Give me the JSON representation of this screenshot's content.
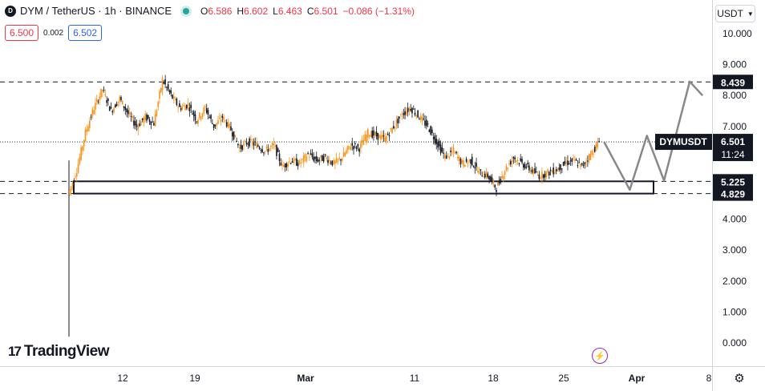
{
  "header": {
    "logo_letter": "D",
    "title": "DYM / TetherUS · 1h · BINANCE",
    "ohlc": [
      {
        "key": "O",
        "value": "6.586"
      },
      {
        "key": "H",
        "value": "6.602"
      },
      {
        "key": "L",
        "value": "6.463"
      },
      {
        "key": "C",
        "value": "6.501"
      },
      {
        "key": "",
        "value": "−0.086 (−1.31%)"
      }
    ]
  },
  "trade": {
    "sell_price": "6.500",
    "spread": "0.002",
    "buy_price": "6.502"
  },
  "currency": {
    "label": "USDT",
    "icon": "chevron-down-icon"
  },
  "colors": {
    "up": "#f7931a",
    "down": "#131722",
    "accent_red": "#f23645",
    "accent_blue": "#2962ff",
    "live_green": "#26a69a",
    "projection": "#888888"
  },
  "chart_data": {
    "type": "candlestick",
    "y_axis_ticks": [
      "10.000",
      "9.000",
      "8.000",
      "7.000",
      "4.000",
      "3.000",
      "2.000",
      "1.000",
      "0.000"
    ],
    "ylim": [
      0,
      10.6
    ],
    "x_axis_ticks": [
      "12",
      "19",
      "Mar",
      "11",
      "18",
      "25",
      "Apr",
      "8"
    ],
    "price_series": [
      {
        "t": 0,
        "v": 4.8
      },
      {
        "t": 1,
        "v": 5.6
      },
      {
        "t": 2,
        "v": 6.8
      },
      {
        "t": 3,
        "v": 7.6
      },
      {
        "t": 4,
        "v": 8.2
      },
      {
        "t": 5,
        "v": 7.5
      },
      {
        "t": 6,
        "v": 7.9
      },
      {
        "t": 7,
        "v": 7.4
      },
      {
        "t": 8,
        "v": 7.0
      },
      {
        "t": 9,
        "v": 7.3
      },
      {
        "t": 10,
        "v": 7.1
      },
      {
        "t": 11,
        "v": 8.5
      },
      {
        "t": 12,
        "v": 8.0
      },
      {
        "t": 13,
        "v": 7.6
      },
      {
        "t": 14,
        "v": 7.7
      },
      {
        "t": 15,
        "v": 7.2
      },
      {
        "t": 16,
        "v": 7.6
      },
      {
        "t": 17,
        "v": 7.0
      },
      {
        "t": 18,
        "v": 7.3
      },
      {
        "t": 19,
        "v": 6.9
      },
      {
        "t": 20,
        "v": 6.3
      },
      {
        "t": 21,
        "v": 6.5
      },
      {
        "t": 22,
        "v": 6.4
      },
      {
        "t": 23,
        "v": 6.2
      },
      {
        "t": 24,
        "v": 6.4
      },
      {
        "t": 25,
        "v": 5.7
      },
      {
        "t": 26,
        "v": 5.9
      },
      {
        "t": 27,
        "v": 5.8
      },
      {
        "t": 28,
        "v": 6.1
      },
      {
        "t": 29,
        "v": 5.9
      },
      {
        "t": 30,
        "v": 6.0
      },
      {
        "t": 31,
        "v": 5.8
      },
      {
        "t": 32,
        "v": 6.0
      },
      {
        "t": 33,
        "v": 6.4
      },
      {
        "t": 34,
        "v": 6.3
      },
      {
        "t": 35,
        "v": 6.8
      },
      {
        "t": 36,
        "v": 6.7
      },
      {
        "t": 37,
        "v": 6.6
      },
      {
        "t": 38,
        "v": 7.0
      },
      {
        "t": 39,
        "v": 7.4
      },
      {
        "t": 40,
        "v": 7.6
      },
      {
        "t": 41,
        "v": 7.3
      },
      {
        "t": 42,
        "v": 7.0
      },
      {
        "t": 43,
        "v": 6.5
      },
      {
        "t": 44,
        "v": 6.0
      },
      {
        "t": 45,
        "v": 6.2
      },
      {
        "t": 46,
        "v": 5.8
      },
      {
        "t": 47,
        "v": 5.9
      },
      {
        "t": 48,
        "v": 5.5
      },
      {
        "t": 49,
        "v": 5.4
      },
      {
        "t": 50,
        "v": 5.0
      },
      {
        "t": 51,
        "v": 5.6
      },
      {
        "t": 52,
        "v": 6.0
      },
      {
        "t": 53,
        "v": 5.8
      },
      {
        "t": 54,
        "v": 5.6
      },
      {
        "t": 55,
        "v": 5.4
      },
      {
        "t": 56,
        "v": 5.5
      },
      {
        "t": 57,
        "v": 5.6
      },
      {
        "t": 58,
        "v": 5.8
      },
      {
        "t": 59,
        "v": 5.9
      },
      {
        "t": 60,
        "v": 5.7
      },
      {
        "t": 61,
        "v": 6.1
      },
      {
        "t": 62,
        "v": 6.5
      }
    ],
    "price_series_t_max": 62,
    "horizontal_levels": [
      {
        "value": 8.439,
        "label": "8.439"
      },
      {
        "value": 5.225,
        "label": "5.225"
      },
      {
        "value": 4.829,
        "label": "4.829"
      }
    ],
    "current_price": {
      "value": 6.501,
      "label": "6.501",
      "symbol": "DYMUSDT",
      "countdown": "11:24"
    },
    "zone": {
      "low": 4.829,
      "high": 5.225
    },
    "projection_path": [
      {
        "t": 62.5,
        "v": 6.5
      },
      {
        "t": 65.5,
        "v": 4.95
      },
      {
        "t": 67.5,
        "v": 6.7
      },
      {
        "t": 69.5,
        "v": 5.25
      },
      {
        "t": 72.5,
        "v": 8.45
      },
      {
        "t": 74.0,
        "v": 8.0
      }
    ]
  },
  "footer": {
    "brand": "TradingView",
    "brand_mark": "17",
    "flash_icon": "lightning-icon",
    "settings_icon": "gear-icon"
  }
}
